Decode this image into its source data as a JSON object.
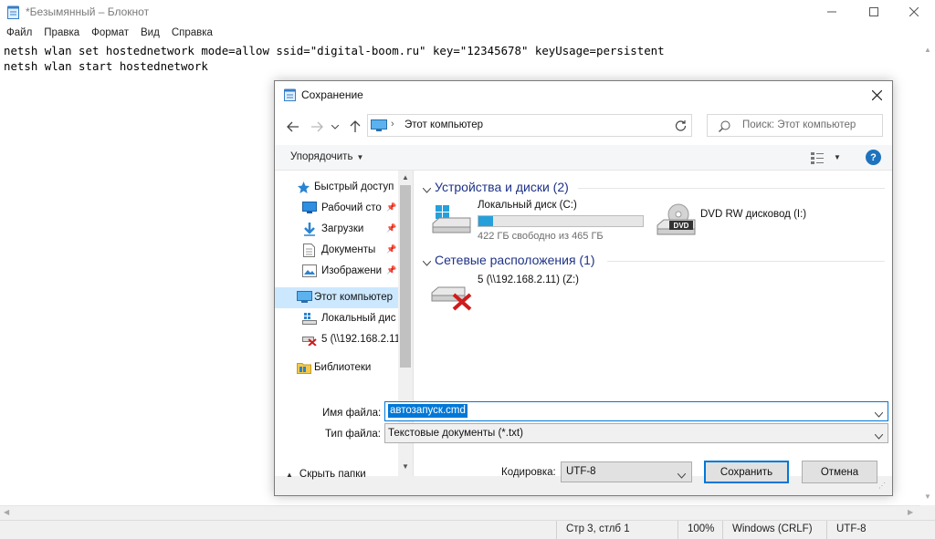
{
  "notepad": {
    "title": "*Безымянный – Блокнот",
    "menu": [
      "Файл",
      "Правка",
      "Формат",
      "Вид",
      "Справка"
    ],
    "lines": [
      "netsh wlan set hostednetwork mode=allow ssid=\"digital-boom.ru\" key=\"12345678\" keyUsage=persistent",
      "netsh wlan start hostednetwork"
    ],
    "status": {
      "position": "Стр 3, стлб 1",
      "zoom": "100%",
      "line_ending": "Windows (CRLF)",
      "encoding": "UTF-8"
    }
  },
  "dialog": {
    "title": "Сохранение",
    "address": "Этот компьютер",
    "search_placeholder": "Поиск: Этот компьютер",
    "organize_label": "Упорядочить",
    "help_label": "?",
    "tree": [
      {
        "label": "Быстрый доступ",
        "icon": "star-icon",
        "pinned": false
      },
      {
        "label": "Рабочий сто",
        "icon": "desktop-icon",
        "pinned": true
      },
      {
        "label": "Загрузки",
        "icon": "download-icon",
        "pinned": true
      },
      {
        "label": "Документы",
        "icon": "documents-icon",
        "pinned": true
      },
      {
        "label": "Изображени",
        "icon": "pictures-icon",
        "pinned": true
      },
      {
        "label": "Этот компьютер",
        "icon": "computer-icon",
        "pinned": false,
        "selected": true
      },
      {
        "label": "Локальный дис",
        "icon": "local-disk-icon",
        "pinned": false
      },
      {
        "label": "5 (\\\\192.168.2.11",
        "icon": "network-drive-disconnected-icon",
        "pinned": false
      },
      {
        "label": "Библиотеки",
        "icon": "libraries-icon",
        "pinned": false
      }
    ],
    "groups": {
      "devices": {
        "title": "Устройства и диски (2)",
        "local_disk": {
          "name": "Локальный диск (C:)",
          "free": "422 ГБ свободно из 465 ГБ",
          "used_fraction": 0.09
        },
        "dvd": {
          "name": "DVD RW дисковод (I:)",
          "badge": "DVD"
        }
      },
      "network": {
        "title": "Сетевые расположения (1)",
        "drive": {
          "name": "5 (\\\\192.168.2.11) (Z:)"
        }
      }
    },
    "filename_label": "Имя файла:",
    "filename_value": "автозапуск.cmd",
    "filetype_label": "Тип файла:",
    "filetype_value": "Текстовые документы (*.txt)",
    "hide_folders_label": "Скрыть папки",
    "encoding_label": "Кодировка:",
    "encoding_value": "UTF-8",
    "save_label": "Сохранить",
    "cancel_label": "Отмена"
  },
  "colors": {
    "accent": "#0078d7",
    "group_title": "#1e3287",
    "selection": "#cce8ff",
    "disk_fill": "#26a0da"
  }
}
